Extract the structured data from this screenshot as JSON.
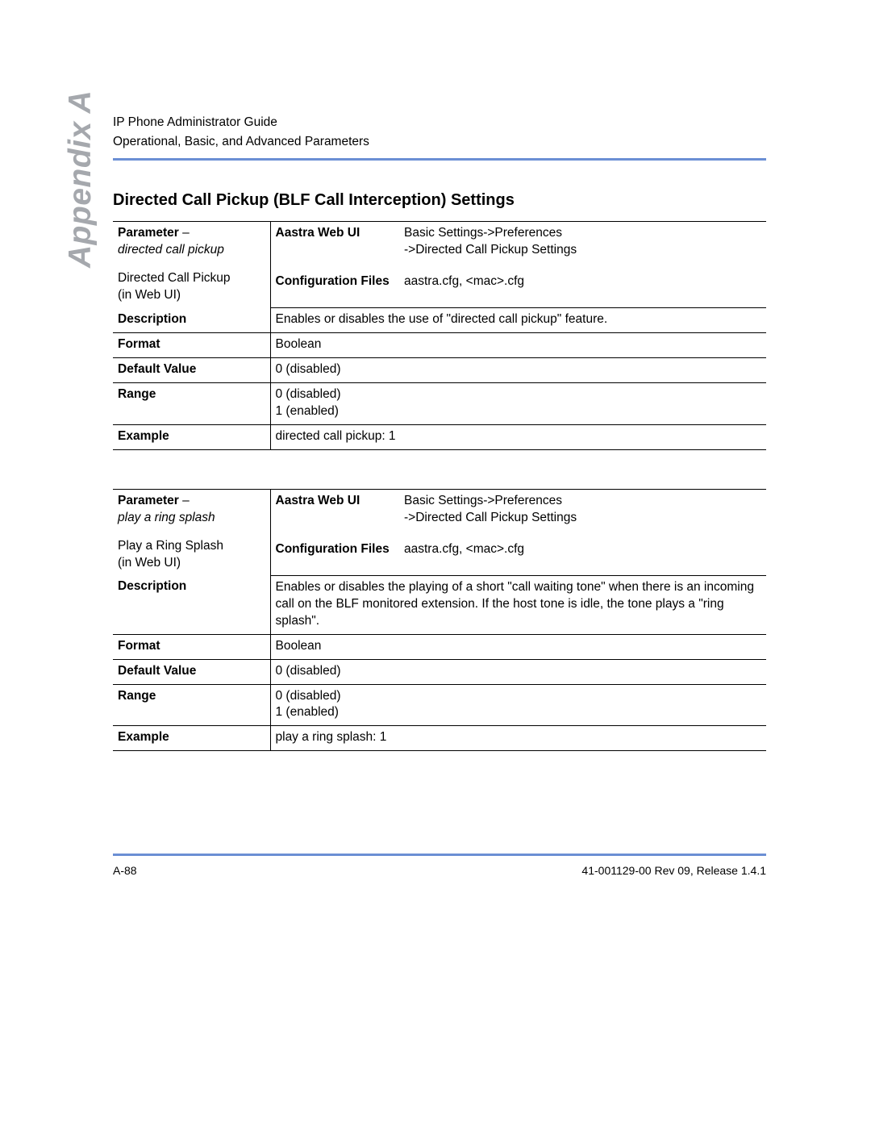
{
  "header": {
    "line1": "IP Phone Administrator Guide",
    "line2": "Operational, Basic, and Advanced Parameters"
  },
  "side_label": "Appendix A",
  "section_title": "Directed Call Pickup (BLF Call Interception) Settings",
  "table1": {
    "parameter_label": "Parameter",
    "parameter_dash": " –",
    "parameter_italic": "directed call pickup",
    "webui_name_line1": "Directed Call Pickup",
    "webui_name_line2": "(in Web UI)",
    "aastra_label": "Aastra Web UI",
    "aastra_path1": "Basic Settings->Preferences",
    "aastra_path2": "->Directed Call Pickup Settings",
    "config_label": "Configuration Files",
    "config_value": "aastra.cfg, <mac>.cfg",
    "desc_label": "Description",
    "desc_value": "Enables or disables the use of \"directed call pickup\" feature.",
    "format_label": "Format",
    "format_value": "Boolean",
    "default_label": "Default Value",
    "default_value": "0 (disabled)",
    "range_label": "Range",
    "range_line1": "0 (disabled)",
    "range_line2": "1 (enabled)",
    "example_label": "Example",
    "example_value": "directed call pickup: 1"
  },
  "table2": {
    "parameter_label": "Parameter",
    "parameter_dash": " –",
    "parameter_italic": "play a ring splash",
    "webui_name_line1": "Play a Ring Splash",
    "webui_name_line2": "(in Web UI)",
    "aastra_label": "Aastra Web UI",
    "aastra_path1": "Basic Settings->Preferences",
    "aastra_path2": "->Directed Call Pickup Settings",
    "config_label": "Configuration Files",
    "config_value": "aastra.cfg, <mac>.cfg",
    "desc_label": "Description",
    "desc_value": "Enables or disables the playing of a short \"call waiting tone\" when there is an incoming call on the BLF monitored extension. If the host tone is idle, the tone plays a \"ring splash\".",
    "format_label": "Format",
    "format_value": "Boolean",
    "default_label": "Default Value",
    "default_value": "0 (disabled)",
    "range_label": "Range",
    "range_line1": "0 (disabled)",
    "range_line2": "1 (enabled)",
    "example_label": "Example",
    "example_value": "play a ring splash: 1"
  },
  "footer": {
    "left": "A-88",
    "right": "41-001129-00 Rev 09, Release 1.4.1"
  }
}
